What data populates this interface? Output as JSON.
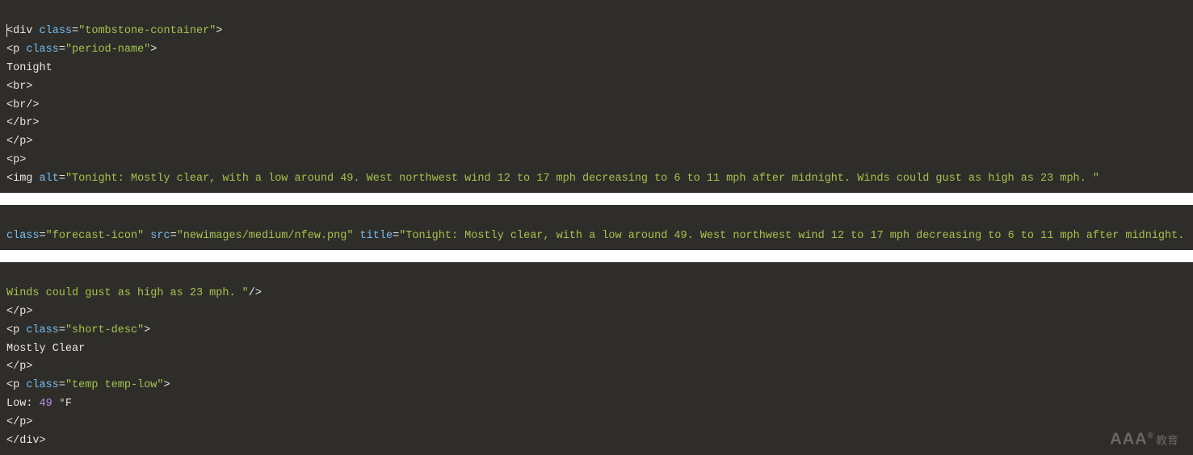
{
  "block1": {
    "l1": {
      "open": "<",
      "elem": "div",
      "sp": " ",
      "attrClass": "class",
      "eq": "=",
      "valClass": "\"tombstone-container\"",
      "close": ">"
    },
    "l2": {
      "open": "<",
      "elem": "p",
      "sp": " ",
      "attrClass": "class",
      "eq": "=",
      "valClass": "\"period-name\"",
      "close": ">"
    },
    "l3": {
      "text": "Tonight"
    },
    "l4": {
      "open": "<",
      "elem": "br",
      "close": ">"
    },
    "l5": {
      "open": "<",
      "elem": "br",
      "slash": "/",
      "close": ">"
    },
    "l6": {
      "open": "<",
      "slash": "/",
      "elem": "br",
      "close": ">"
    },
    "l7": {
      "open": "<",
      "slash": "/",
      "elem": "p",
      "close": ">"
    },
    "l8": {
      "open": "<",
      "elem": "p",
      "close": ">"
    },
    "l9": {
      "open": "<",
      "elem": "img",
      "sp": " ",
      "attrAlt": "alt",
      "eq": "=",
      "valAlt": "\"Tonight: Mostly clear, with a low around 49. West northwest wind 12 to 17 mph decreasing to 6 to 11 mph after midnight. Winds could gust as high as 23 mph. \""
    }
  },
  "block2": {
    "l1": {
      "attrClass": "class",
      "eq1": "=",
      "valClass": "\"forecast-icon\"",
      "sp1": " ",
      "attrSrc": "src",
      "eq2": "=",
      "valSrc": "\"newimages/medium/nfew.png\"",
      "sp2": " ",
      "attrTitle": "title",
      "eq3": "=",
      "valTitle": "\"Tonight: Mostly clear, with a low around 49. West northwest wind 12 to 17 mph decreasing to 6 to 11 mph after midnight."
    }
  },
  "block3": {
    "l1": {
      "cont": "Winds could gust as high as 23 mph. \"",
      "slash": "/",
      "close": ">"
    },
    "l2": {
      "open": "<",
      "slash": "/",
      "elem": "p",
      "close": ">"
    },
    "l3": {
      "open": "<",
      "elem": "p",
      "sp": " ",
      "attrClass": "class",
      "eq": "=",
      "valClass": "\"short-desc\"",
      "close": ">"
    },
    "l4": {
      "text": "Mostly Clear"
    },
    "l5": {
      "open": "<",
      "slash": "/",
      "elem": "p",
      "close": ">"
    },
    "l6": {
      "open": "<",
      "elem": "p",
      "sp": " ",
      "attrClass": "class",
      "eq": "=",
      "valClass": "\"temp temp-low\"",
      "close": ">"
    },
    "l7": {
      "pre": "Low: ",
      "num": "49",
      "post": " °F"
    },
    "l8": {
      "open": "<",
      "slash": "/",
      "elem": "p",
      "close": ">"
    },
    "l9": {
      "open": "<",
      "slash": "/",
      "elem": "div",
      "close": ">"
    }
  },
  "watermark": {
    "text": "AAA",
    "sup": "®",
    "cjk": "教育"
  }
}
